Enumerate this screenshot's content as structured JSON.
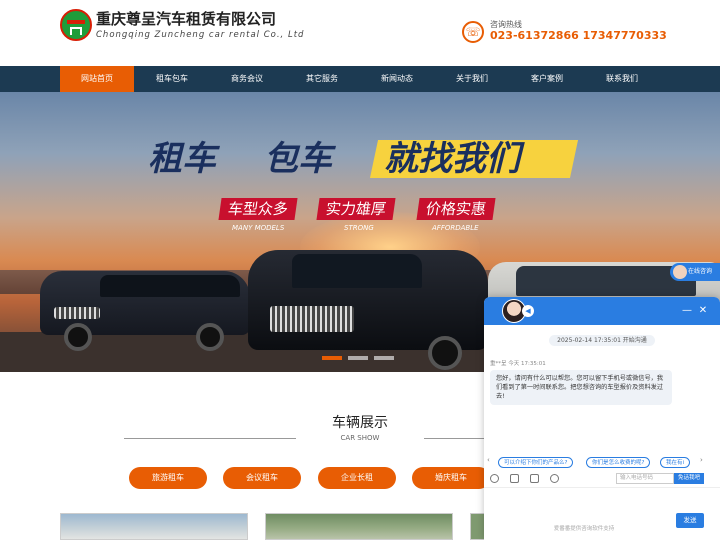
{
  "header": {
    "company_cn": "重庆尊呈汽车租赁有限公司",
    "company_en": "Chongqing Zuncheng car rental Co., Ltd",
    "hotline_label": "咨询热线",
    "hotline_numbers": "023-61372866 17347770333"
  },
  "nav": {
    "items": [
      {
        "label": "网站首页",
        "active": true
      },
      {
        "label": "租车包车"
      },
      {
        "label": "商务会议"
      },
      {
        "label": "其它服务"
      },
      {
        "label": "新闻动态"
      },
      {
        "label": "关于我们"
      },
      {
        "label": "客户案例"
      },
      {
        "label": "联系我们"
      }
    ]
  },
  "banner": {
    "title_part1": "租车",
    "title_part2": "包车",
    "title_part3": "就找我们",
    "badges": [
      {
        "cn": "车型众多",
        "en": "MANY MODELS"
      },
      {
        "cn": "实力雄厚",
        "en": "STRONG"
      },
      {
        "cn": "价格实惠",
        "en": "AFFORDABLE"
      }
    ]
  },
  "car_show": {
    "title": "车辆展示",
    "subtitle": "CAR SHOW",
    "categories": [
      "旅游租车",
      "会议租车",
      "企业长租",
      "婚庆租车"
    ]
  },
  "float_consult": {
    "label": "在线咨询"
  },
  "chat": {
    "start_time": "2025-02-14 17:35:01 开始沟通",
    "sender": "重**呈  今天 17:35:01",
    "message": "您好，请问有什么可以帮您。您可以留下手机号或微信号，我们看到了第一时间联系您。把您想咨询的车型报价及资料发过去!",
    "quick_replies": [
      "可以介绍下你们的产品么?",
      "你们是怎么收费的呢?",
      "我在有i"
    ],
    "phone_placeholder": "输入电话号码",
    "phone_button": "免话我吧",
    "send_button": "发送",
    "footer": "爱番番提供咨询软件支持"
  },
  "colors": {
    "accent": "#e85d04",
    "nav_bg": "#1c3a52",
    "chat_blue": "#2a7de1"
  }
}
